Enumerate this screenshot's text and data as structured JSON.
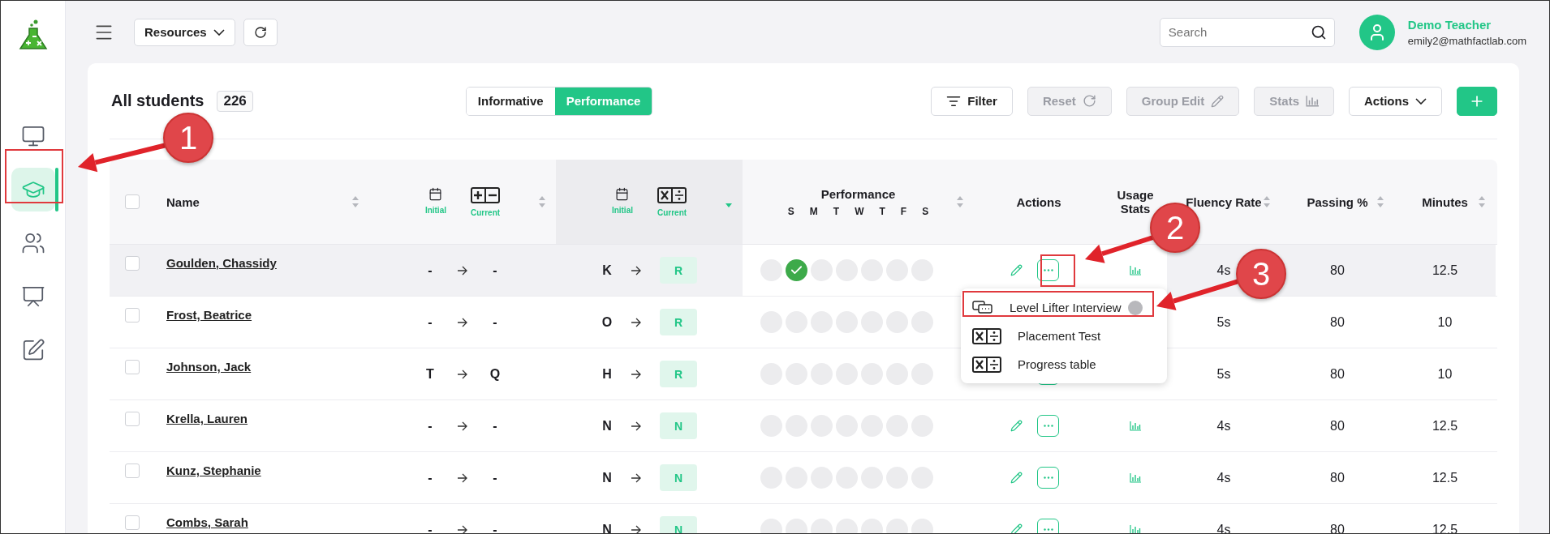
{
  "sidebar": {
    "items": [
      {
        "kind": "classroom",
        "selected": false
      },
      {
        "kind": "students",
        "selected": true
      },
      {
        "kind": "teaching",
        "selected": false
      },
      {
        "kind": "reports",
        "selected": false
      },
      {
        "kind": "edit",
        "selected": false
      }
    ]
  },
  "topbar": {
    "resources": "Resources",
    "search": {
      "placeholder": "Search"
    },
    "user": {
      "name": "Demo Teacher",
      "email": "emily2@mathfactlab.com"
    }
  },
  "card": {
    "title": "All students",
    "count": "226",
    "views": [
      {
        "label": "Informative",
        "selected": false
      },
      {
        "label": "Performance",
        "selected": true
      }
    ],
    "buttons": [
      {
        "kind": "filter",
        "label": "Filter",
        "disabled": false
      },
      {
        "kind": "reset",
        "label": "Reset",
        "disabled": true
      },
      {
        "kind": "edit",
        "label": "Group Edit",
        "disabled": true
      },
      {
        "kind": "stats",
        "label": "Stats",
        "disabled": true
      },
      {
        "kind": "dropdown",
        "label": "Actions",
        "disabled": false
      },
      {
        "kind": "add",
        "disabled": false
      }
    ]
  },
  "table": {
    "columns": [
      {
        "kind": "check",
        "checked": false
      },
      {
        "kind": "name",
        "label": "Name",
        "sorted": false
      },
      {
        "kind": "addsub",
        "initial": "Initial",
        "current": "Current",
        "sorted": false
      },
      {
        "kind": "muldiv",
        "initial": "Initial",
        "current": "Current",
        "sorted": true
      },
      {
        "kind": "week",
        "label": "Performance",
        "days": [
          "S",
          "M",
          "T",
          "W",
          "T",
          "F",
          "S"
        ],
        "sorted": false
      },
      {
        "kind": "actions",
        "label": "Actions"
      },
      {
        "kind": "usage",
        "label": "Usage Stats"
      },
      {
        "kind": "fluency",
        "label": "Fluency Rate",
        "sorted": false
      },
      {
        "kind": "passing",
        "label": "Passing %",
        "sorted": false
      },
      {
        "kind": "minutes",
        "label": "Minutes",
        "sorted": false
      }
    ],
    "rows": [
      {
        "name": "Goulden, Chassidy",
        "checked": false,
        "highlighted": true,
        "addsub": {
          "initial": "-",
          "current": "-"
        },
        "muldiv": {
          "initial": "K",
          "current": "R"
        },
        "week": [
          false,
          true,
          false,
          false,
          false,
          false,
          false
        ],
        "fluency": "4s",
        "passing": "80",
        "minutes": "12.5"
      },
      {
        "name": "Frost, Beatrice",
        "checked": false,
        "highlighted": false,
        "addsub": {
          "initial": "-",
          "current": "-"
        },
        "muldiv": {
          "initial": "O",
          "current": "R"
        },
        "week": [
          false,
          false,
          false,
          false,
          false,
          false,
          false
        ],
        "fluency": "5s",
        "passing": "80",
        "minutes": "10"
      },
      {
        "name": "Johnson, Jack",
        "checked": false,
        "highlighted": false,
        "addsub": {
          "initial": "T",
          "current": "Q"
        },
        "muldiv": {
          "initial": "H",
          "current": "R"
        },
        "week": [
          false,
          false,
          false,
          false,
          false,
          false,
          false
        ],
        "fluency": "5s",
        "passing": "80",
        "minutes": "10"
      },
      {
        "name": "Krella, Lauren",
        "checked": false,
        "highlighted": false,
        "addsub": {
          "initial": "-",
          "current": "-"
        },
        "muldiv": {
          "initial": "N",
          "current": "N"
        },
        "week": [
          false,
          false,
          false,
          false,
          false,
          false,
          false
        ],
        "fluency": "4s",
        "passing": "80",
        "minutes": "12.5"
      },
      {
        "name": "Kunz, Stephanie",
        "checked": false,
        "highlighted": false,
        "addsub": {
          "initial": "-",
          "current": "-"
        },
        "muldiv": {
          "initial": "N",
          "current": "N"
        },
        "week": [
          false,
          false,
          false,
          false,
          false,
          false,
          false
        ],
        "fluency": "4s",
        "passing": "80",
        "minutes": "12.5"
      },
      {
        "name": "Combs, Sarah",
        "checked": false,
        "highlighted": false,
        "addsub": {
          "initial": "-",
          "current": "-"
        },
        "muldiv": {
          "initial": "N",
          "current": "N"
        },
        "week": [
          false,
          false,
          false,
          false,
          false,
          false,
          false
        ],
        "fluency": "4s",
        "passing": "80",
        "minutes": "12.5"
      }
    ]
  },
  "action_menu": {
    "items": [
      {
        "kind": "interview",
        "label": "Level Lifter Interview"
      },
      {
        "kind": "test",
        "label": "Placement Test"
      },
      {
        "kind": "table",
        "label": "Progress table"
      }
    ]
  },
  "annotations": [
    {
      "label": "1"
    },
    {
      "label": "2"
    },
    {
      "label": "3"
    }
  ]
}
